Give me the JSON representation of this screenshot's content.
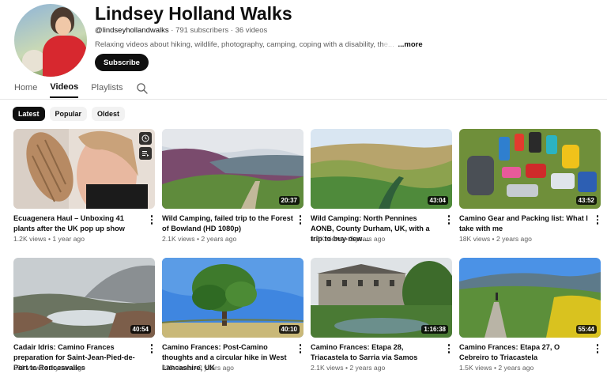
{
  "channel": {
    "name": "Lindsey Holland Walks",
    "handle": "@lindseyhollandwalks",
    "subscribers": "791 subscribers",
    "video_count": "36 videos",
    "description": "Relaxing videos about hiking, wildlife, photography, camping, coping with a disability, th",
    "description_fade": "e...",
    "more_label": "...more",
    "subscribe_label": "Subscribe"
  },
  "tabs": [
    {
      "label": "Home"
    },
    {
      "label": "Videos"
    },
    {
      "label": "Playlists"
    }
  ],
  "active_tab": "Videos",
  "chips": [
    {
      "label": "Latest"
    },
    {
      "label": "Popular"
    },
    {
      "label": "Oldest"
    }
  ],
  "active_chip": "Latest",
  "videos": [
    {
      "title": "Ecuagenera Haul – Unboxing 41 plants after the UK pop up show",
      "views": "1.2K views",
      "age": "1 year ago",
      "duration": "",
      "thumb": "unboxing-plant"
    },
    {
      "title": "Wild Camping, failed trip to the Forest of Bowland (HD 1080p)",
      "views": "2.1K views",
      "age": "2 years ago",
      "duration": "20:37",
      "thumb": "heather-moor"
    },
    {
      "title": "Wild Camping: North Pennines AONB, County Durham, UK, with a trip to buy new…",
      "views": "1.5K views",
      "age": "2 years ago",
      "duration": "43:04",
      "thumb": "green-valley"
    },
    {
      "title": "Camino Gear and Packing list: What I take with me",
      "views": "18K views",
      "age": "2 years ago",
      "duration": "43:52",
      "thumb": "gear-layout"
    },
    {
      "title": "Cadair Idris: Camino Frances preparation for Saint-Jean-Pied-de-Port to Roncesvalles",
      "views": "591 views",
      "age": "2 years ago",
      "duration": "40:54",
      "thumb": "misty-lake"
    },
    {
      "title": "Camino Frances: Post-Camino thoughts and a circular hike in West Lancashire, UK",
      "views": "935 views",
      "age": "2 years ago",
      "duration": "40:10",
      "thumb": "tree-sky"
    },
    {
      "title": "Camino Frances: Etapa 28, Triacastela to Sarria via Samos",
      "views": "2.1K views",
      "age": "2 years ago",
      "duration": "1:16:38",
      "thumb": "monastery"
    },
    {
      "title": "Camino Frances: Etapa 27, O Cebreiro to Triacastela",
      "views": "1.5K views",
      "age": "2 years ago",
      "duration": "55:44",
      "thumb": "mountain-path"
    }
  ],
  "icons": {
    "search": "search-icon",
    "watch_later": "clock-icon",
    "add_to_queue": "queue-icon",
    "more": "kebab-icon"
  }
}
